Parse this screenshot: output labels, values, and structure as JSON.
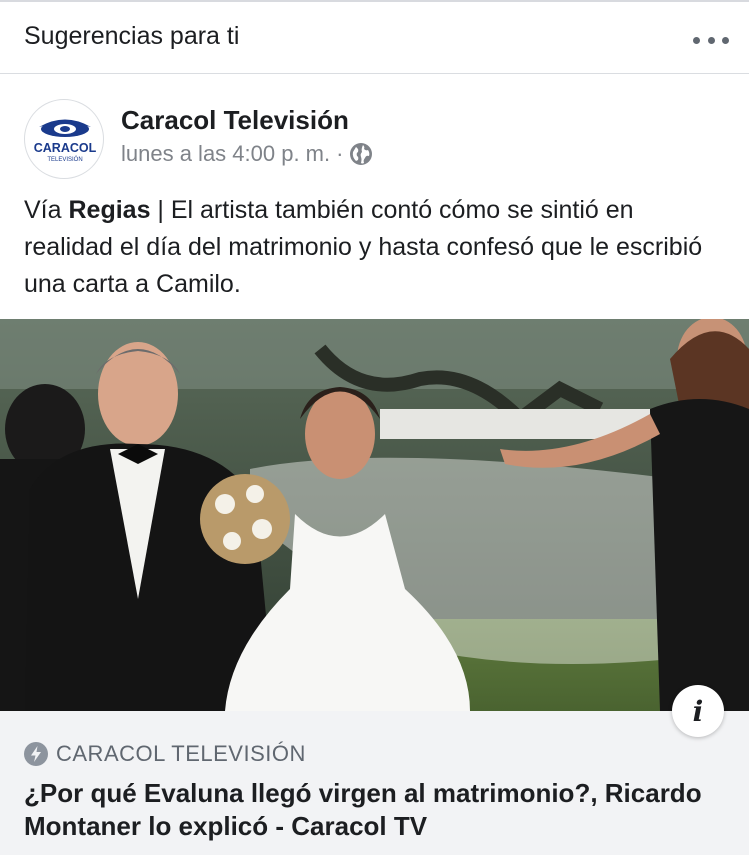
{
  "suggestions": {
    "title": "Sugerencias para ti",
    "more_icon": "more-horizontal-icon"
  },
  "post": {
    "page_name": "Caracol Televisión",
    "logo": {
      "word": "CARACOL",
      "subword": "TELEVISIÓN",
      "brand_color": "#1a3a8c"
    },
    "timestamp": "lunes a las 4:00 p. m.",
    "separator": "·",
    "privacy_icon": "globe-icon",
    "text_prefix": "Vía ",
    "text_bold": "Regias",
    "text_rest": " | El artista también contó cómo se sintió en realidad el día del matrimonio y hasta confesó que le escribió una carta a Camilo."
  },
  "link": {
    "info_label": "i",
    "domain": "CARACOL TELEVISIÓN",
    "title": "¿Por qué Evaluna llegó virgen al matrimonio?, Ricardo Montaner lo explicó - Caracol TV"
  },
  "colors": {
    "text": "#1c1e21",
    "secondary": "#606770",
    "link_bar_bg": "#f2f3f5"
  }
}
